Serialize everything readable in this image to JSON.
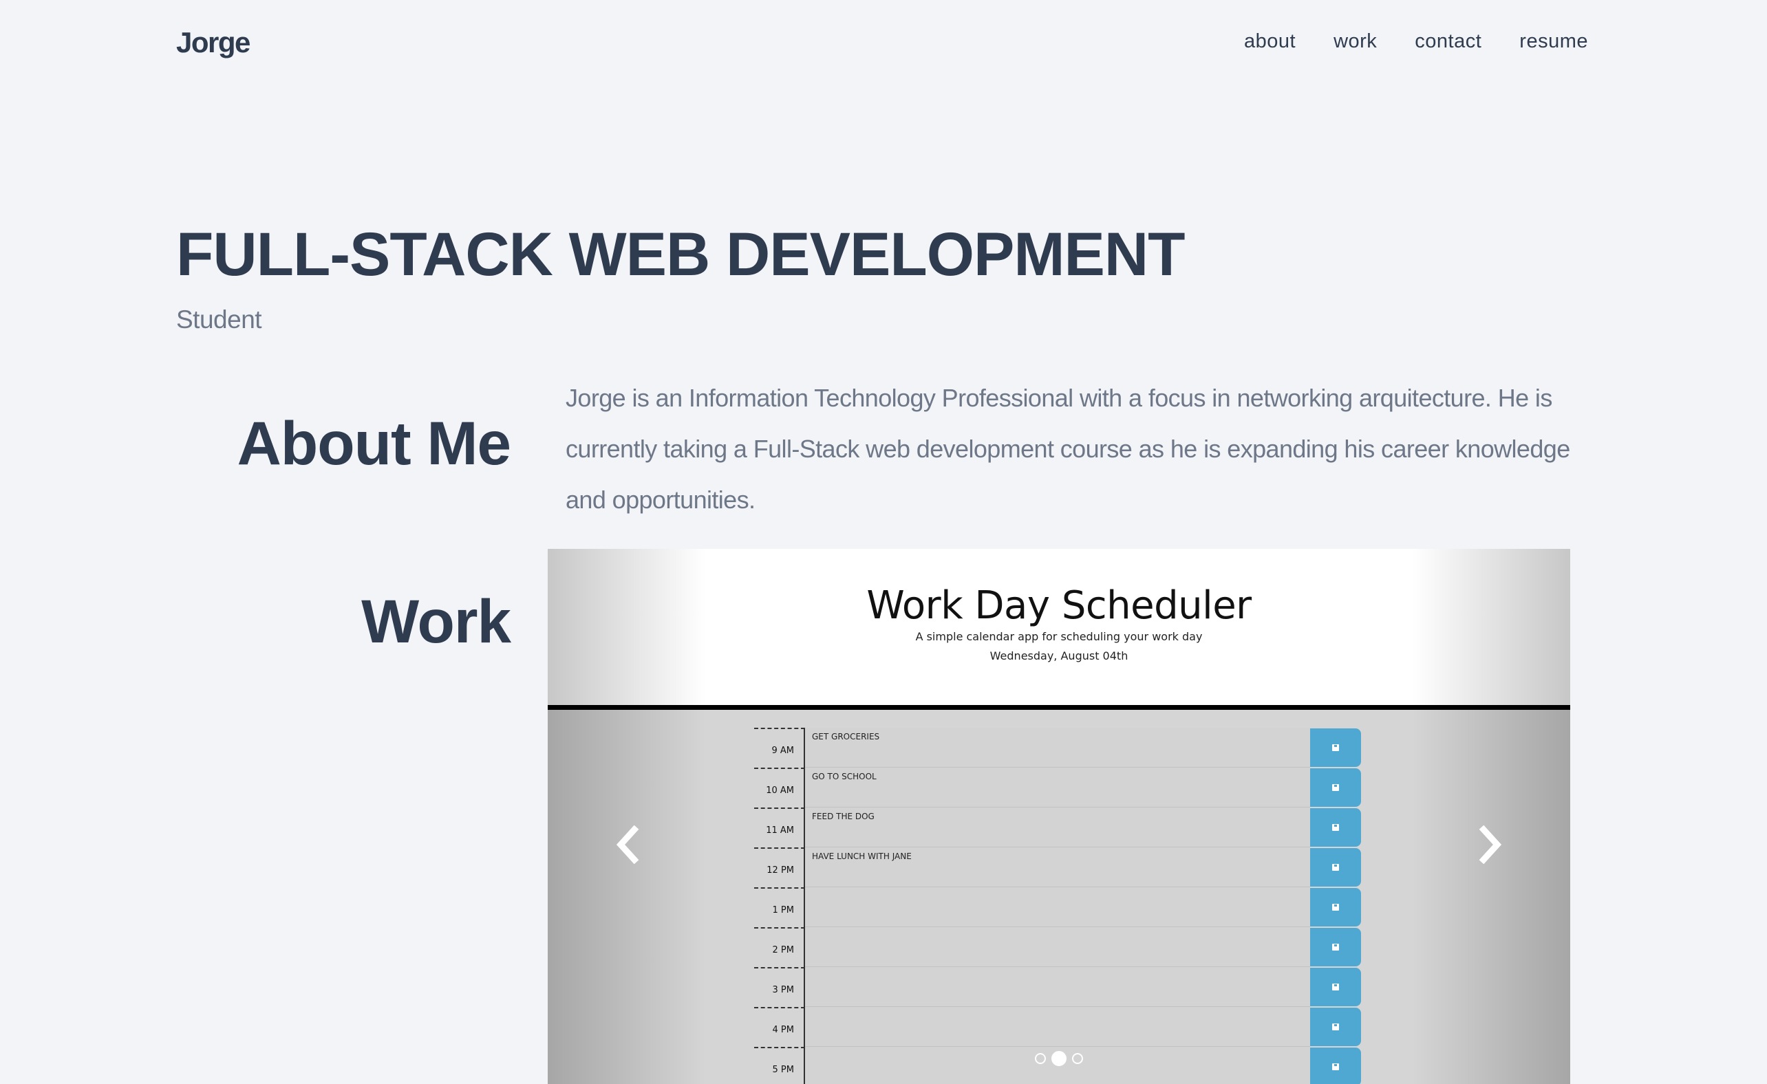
{
  "nav": {
    "brand": "Jorge",
    "links": [
      "about",
      "work",
      "contact",
      "resume"
    ]
  },
  "hero": {
    "title": "FULL-STACK WEB DEVELOPMENT",
    "subtitle": "Student"
  },
  "about": {
    "heading": "About Me",
    "text": "Jorge is an Information Technology Professional with a focus in networking arquitecture. He is currently taking a Full-Stack web development course as he is expanding his career knowledge and opportunities."
  },
  "work": {
    "heading": "Work",
    "slide": {
      "title": "Work Day Scheduler",
      "tagline": "A simple calendar app for scheduling your work day",
      "date": "Wednesday, August 04th",
      "rows": [
        {
          "hour": "9 AM",
          "task": "GET GROCERIES"
        },
        {
          "hour": "10 AM",
          "task": "GO TO SCHOOL"
        },
        {
          "hour": "11 AM",
          "task": "FEED THE DOG"
        },
        {
          "hour": "12 PM",
          "task": "HAVE LUNCH WITH JANE"
        },
        {
          "hour": "1 PM",
          "task": ""
        },
        {
          "hour": "2 PM",
          "task": ""
        },
        {
          "hour": "3 PM",
          "task": ""
        },
        {
          "hour": "4 PM",
          "task": ""
        },
        {
          "hour": "5 PM",
          "task": ""
        }
      ]
    },
    "carousel": {
      "active_index": 1,
      "count": 3,
      "prev_icon": "chevron-left-icon",
      "next_icon": "chevron-right-icon"
    }
  },
  "colors": {
    "background": "#f2f4f7",
    "heading": "#2f3b4f",
    "body_text": "#6d7788",
    "save_button": "#4ea8d2"
  }
}
